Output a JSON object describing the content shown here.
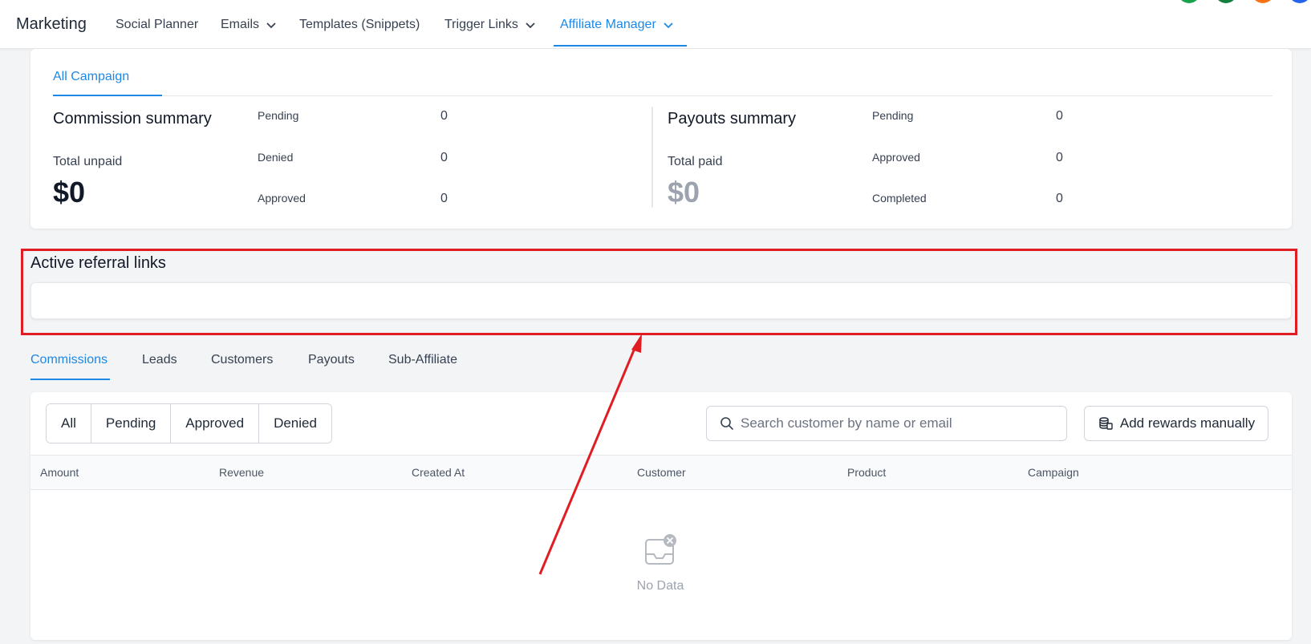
{
  "nav": {
    "brand": "Marketing",
    "items": [
      {
        "label": "Social Planner"
      },
      {
        "label": "Emails"
      },
      {
        "label": "Templates (Snippets)"
      },
      {
        "label": "Trigger Links"
      },
      {
        "label": "Affiliate Manager"
      }
    ],
    "avatar_colors": [
      "#16a34a",
      "#15803d",
      "#f97316",
      "#2563eb"
    ]
  },
  "summary": {
    "tab": "All Campaign",
    "commission": {
      "title": "Commission summary",
      "subtitle": "Total unpaid",
      "amount": "$0",
      "stats": [
        {
          "label": "Pending",
          "value": "0"
        },
        {
          "label": "Denied",
          "value": "0"
        },
        {
          "label": "Approved",
          "value": "0"
        }
      ]
    },
    "payouts": {
      "title": "Payouts summary",
      "subtitle": "Total paid",
      "amount": "$0",
      "stats": [
        {
          "label": "Pending",
          "value": "0"
        },
        {
          "label": "Approved",
          "value": "0"
        },
        {
          "label": "Completed",
          "value": "0"
        }
      ]
    }
  },
  "referral": {
    "title": "Active referral links"
  },
  "tabs": [
    "Commissions",
    "Leads",
    "Customers",
    "Payouts",
    "Sub-Affiliate"
  ],
  "commissions": {
    "filters": [
      "All",
      "Pending",
      "Approved",
      "Denied"
    ],
    "search_placeholder": "Search customer by name or email",
    "add_label": "Add rewards manually",
    "columns": [
      "Amount",
      "Revenue",
      "Created At",
      "Customer",
      "Product",
      "Campaign"
    ],
    "empty_text": "No Data"
  },
  "colors": {
    "accent": "#1e88e5",
    "highlight": "#e11d24"
  }
}
